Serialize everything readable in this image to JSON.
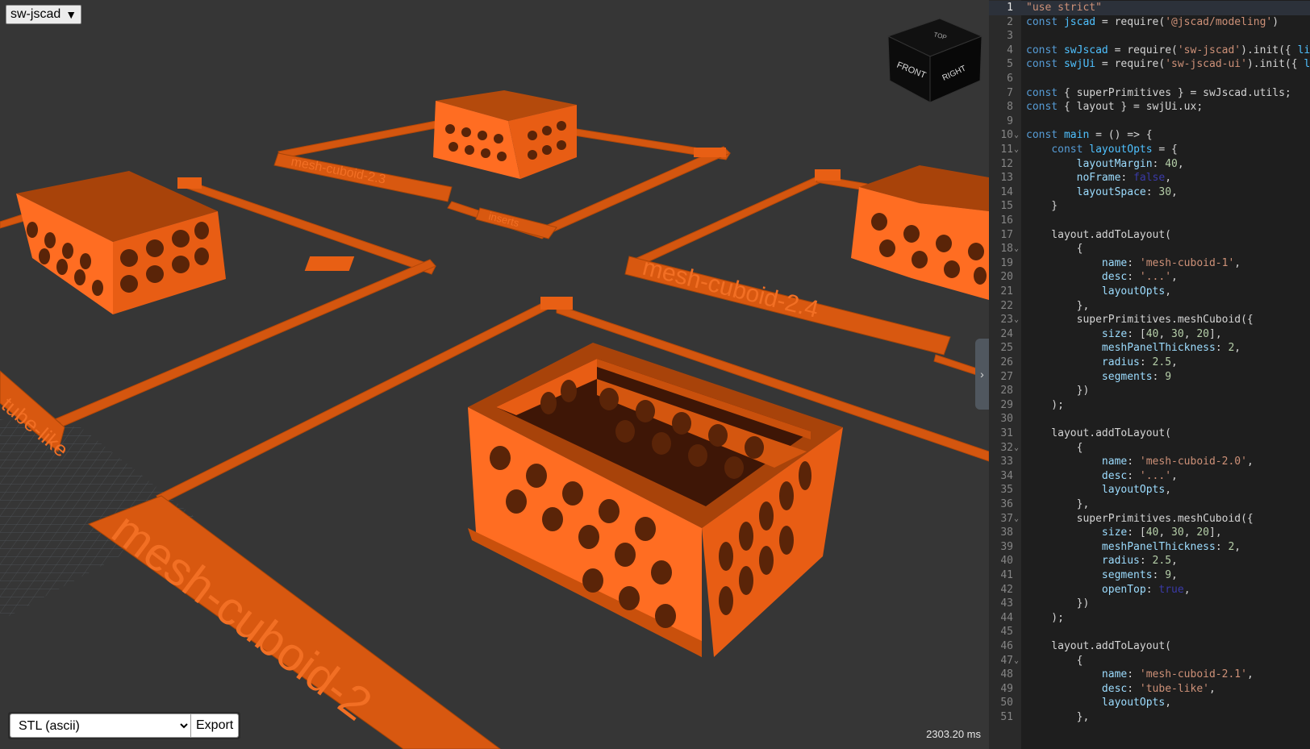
{
  "viewport": {
    "library_dropdown": "sw-jscad",
    "format_select_value": "STL (ascii)",
    "export_button": "Export",
    "render_time": "2303.20 ms",
    "view_cube": {
      "top": "TOP",
      "front": "FRONT",
      "right": "RIGHT"
    },
    "panel_toggle_icon": "chevron-right-icon",
    "model_labels": [
      "mesh-cuboid-2.3",
      "inserts",
      "mesh-cuboid-2.4",
      "tube-like",
      "mesh-cuboid-2"
    ],
    "colors": {
      "model": "#ff6a1a",
      "background": "#363636"
    }
  },
  "editor": {
    "lines": [
      {
        "n": "1",
        "fold": false,
        "tokens": [
          [
            "str",
            "\"use strict\""
          ]
        ]
      },
      {
        "n": "2",
        "fold": false,
        "tokens": [
          [
            "kw",
            "const "
          ],
          [
            "var",
            "jscad"
          ],
          [
            "txt",
            " = require("
          ],
          [
            "str",
            "'@jscad/modeling'"
          ],
          [
            "txt",
            ")"
          ]
        ]
      },
      {
        "n": "3",
        "fold": false,
        "tokens": []
      },
      {
        "n": "4",
        "fold": false,
        "tokens": [
          [
            "kw",
            "const "
          ],
          [
            "var",
            "swJscad"
          ],
          [
            "txt",
            " = require("
          ],
          [
            "str",
            "'sw-jscad'"
          ],
          [
            "txt",
            ").init({ "
          ],
          [
            "var",
            "li"
          ]
        ]
      },
      {
        "n": "5",
        "fold": false,
        "tokens": [
          [
            "kw",
            "const "
          ],
          [
            "var",
            "swjUi"
          ],
          [
            "txt",
            " = require("
          ],
          [
            "str",
            "'sw-jscad-ui'"
          ],
          [
            "txt",
            ").init({ "
          ],
          [
            "var",
            "l"
          ]
        ]
      },
      {
        "n": "6",
        "fold": false,
        "tokens": []
      },
      {
        "n": "7",
        "fold": false,
        "tokens": [
          [
            "kw",
            "const "
          ],
          [
            "txt",
            "{ superPrimitives } = swJscad.utils;"
          ]
        ]
      },
      {
        "n": "8",
        "fold": false,
        "tokens": [
          [
            "kw",
            "const "
          ],
          [
            "txt",
            "{ layout } = swjUi.ux;"
          ]
        ]
      },
      {
        "n": "9",
        "fold": false,
        "tokens": []
      },
      {
        "n": "10",
        "fold": true,
        "tokens": [
          [
            "kw",
            "const "
          ],
          [
            "var",
            "main"
          ],
          [
            "txt",
            " = () => {"
          ]
        ]
      },
      {
        "n": "11",
        "fold": true,
        "tokens": [
          [
            "txt",
            "    "
          ],
          [
            "kw",
            "const "
          ],
          [
            "var",
            "layoutOpts"
          ],
          [
            "txt",
            " = {"
          ]
        ]
      },
      {
        "n": "12",
        "fold": false,
        "tokens": [
          [
            "txt",
            "        "
          ],
          [
            "prop",
            "layoutMargin"
          ],
          [
            "txt",
            ": "
          ],
          [
            "num",
            "40"
          ],
          [
            "txt",
            ","
          ]
        ]
      },
      {
        "n": "13",
        "fold": false,
        "tokens": [
          [
            "txt",
            "        "
          ],
          [
            "prop",
            "noFrame"
          ],
          [
            "txt",
            ": "
          ],
          [
            "bool",
            "false"
          ],
          [
            "txt",
            ","
          ]
        ]
      },
      {
        "n": "14",
        "fold": false,
        "tokens": [
          [
            "txt",
            "        "
          ],
          [
            "prop",
            "layoutSpace"
          ],
          [
            "txt",
            ": "
          ],
          [
            "num",
            "30"
          ],
          [
            "txt",
            ","
          ]
        ]
      },
      {
        "n": "15",
        "fold": false,
        "tokens": [
          [
            "txt",
            "    }"
          ]
        ]
      },
      {
        "n": "16",
        "fold": false,
        "tokens": []
      },
      {
        "n": "17",
        "fold": false,
        "tokens": [
          [
            "txt",
            "    layout.addToLayout("
          ]
        ]
      },
      {
        "n": "18",
        "fold": true,
        "tokens": [
          [
            "txt",
            "        {"
          ]
        ]
      },
      {
        "n": "19",
        "fold": false,
        "tokens": [
          [
            "txt",
            "            "
          ],
          [
            "prop",
            "name"
          ],
          [
            "txt",
            ": "
          ],
          [
            "str",
            "'mesh-cuboid-1'"
          ],
          [
            "txt",
            ","
          ]
        ]
      },
      {
        "n": "20",
        "fold": false,
        "tokens": [
          [
            "txt",
            "            "
          ],
          [
            "prop",
            "desc"
          ],
          [
            "txt",
            ": "
          ],
          [
            "str",
            "'...'"
          ],
          [
            "txt",
            ","
          ]
        ]
      },
      {
        "n": "21",
        "fold": false,
        "tokens": [
          [
            "txt",
            "            "
          ],
          [
            "prop",
            "layoutOpts"
          ],
          [
            "txt",
            ","
          ]
        ]
      },
      {
        "n": "22",
        "fold": false,
        "tokens": [
          [
            "txt",
            "        },"
          ]
        ]
      },
      {
        "n": "23",
        "fold": true,
        "tokens": [
          [
            "txt",
            "        superPrimitives.meshCuboid({"
          ]
        ]
      },
      {
        "n": "24",
        "fold": false,
        "tokens": [
          [
            "txt",
            "            "
          ],
          [
            "prop",
            "size"
          ],
          [
            "txt",
            ": ["
          ],
          [
            "num",
            "40"
          ],
          [
            "txt",
            ", "
          ],
          [
            "num",
            "30"
          ],
          [
            "txt",
            ", "
          ],
          [
            "num",
            "20"
          ],
          [
            "txt",
            "],"
          ]
        ]
      },
      {
        "n": "25",
        "fold": false,
        "tokens": [
          [
            "txt",
            "            "
          ],
          [
            "prop",
            "meshPanelThickness"
          ],
          [
            "txt",
            ": "
          ],
          [
            "num",
            "2"
          ],
          [
            "txt",
            ","
          ]
        ]
      },
      {
        "n": "26",
        "fold": false,
        "tokens": [
          [
            "txt",
            "            "
          ],
          [
            "prop",
            "radius"
          ],
          [
            "txt",
            ": "
          ],
          [
            "num",
            "2.5"
          ],
          [
            "txt",
            ","
          ]
        ]
      },
      {
        "n": "27",
        "fold": false,
        "tokens": [
          [
            "txt",
            "            "
          ],
          [
            "prop",
            "segments"
          ],
          [
            "txt",
            ": "
          ],
          [
            "num",
            "9"
          ]
        ]
      },
      {
        "n": "28",
        "fold": false,
        "tokens": [
          [
            "txt",
            "        })"
          ]
        ]
      },
      {
        "n": "29",
        "fold": false,
        "tokens": [
          [
            "txt",
            "    );"
          ]
        ]
      },
      {
        "n": "30",
        "fold": false,
        "tokens": []
      },
      {
        "n": "31",
        "fold": false,
        "tokens": [
          [
            "txt",
            "    layout.addToLayout("
          ]
        ]
      },
      {
        "n": "32",
        "fold": true,
        "tokens": [
          [
            "txt",
            "        {"
          ]
        ]
      },
      {
        "n": "33",
        "fold": false,
        "tokens": [
          [
            "txt",
            "            "
          ],
          [
            "prop",
            "name"
          ],
          [
            "txt",
            ": "
          ],
          [
            "str",
            "'mesh-cuboid-2.0'"
          ],
          [
            "txt",
            ","
          ]
        ]
      },
      {
        "n": "34",
        "fold": false,
        "tokens": [
          [
            "txt",
            "            "
          ],
          [
            "prop",
            "desc"
          ],
          [
            "txt",
            ": "
          ],
          [
            "str",
            "'...'"
          ],
          [
            "txt",
            ","
          ]
        ]
      },
      {
        "n": "35",
        "fold": false,
        "tokens": [
          [
            "txt",
            "            "
          ],
          [
            "prop",
            "layoutOpts"
          ],
          [
            "txt",
            ","
          ]
        ]
      },
      {
        "n": "36",
        "fold": false,
        "tokens": [
          [
            "txt",
            "        },"
          ]
        ]
      },
      {
        "n": "37",
        "fold": true,
        "tokens": [
          [
            "txt",
            "        superPrimitives.meshCuboid({"
          ]
        ]
      },
      {
        "n": "38",
        "fold": false,
        "tokens": [
          [
            "txt",
            "            "
          ],
          [
            "prop",
            "size"
          ],
          [
            "txt",
            ": ["
          ],
          [
            "num",
            "40"
          ],
          [
            "txt",
            ", "
          ],
          [
            "num",
            "30"
          ],
          [
            "txt",
            ", "
          ],
          [
            "num",
            "20"
          ],
          [
            "txt",
            "],"
          ]
        ]
      },
      {
        "n": "39",
        "fold": false,
        "tokens": [
          [
            "txt",
            "            "
          ],
          [
            "prop",
            "meshPanelThickness"
          ],
          [
            "txt",
            ": "
          ],
          [
            "num",
            "2"
          ],
          [
            "txt",
            ","
          ]
        ]
      },
      {
        "n": "40",
        "fold": false,
        "tokens": [
          [
            "txt",
            "            "
          ],
          [
            "prop",
            "radius"
          ],
          [
            "txt",
            ": "
          ],
          [
            "num",
            "2.5"
          ],
          [
            "txt",
            ","
          ]
        ]
      },
      {
        "n": "41",
        "fold": false,
        "tokens": [
          [
            "txt",
            "            "
          ],
          [
            "prop",
            "segments"
          ],
          [
            "txt",
            ": "
          ],
          [
            "num",
            "9"
          ],
          [
            "txt",
            ","
          ]
        ]
      },
      {
        "n": "42",
        "fold": false,
        "tokens": [
          [
            "txt",
            "            "
          ],
          [
            "prop",
            "openTop"
          ],
          [
            "txt",
            ": "
          ],
          [
            "bool",
            "true"
          ],
          [
            "txt",
            ","
          ]
        ]
      },
      {
        "n": "43",
        "fold": false,
        "tokens": [
          [
            "txt",
            "        })"
          ]
        ]
      },
      {
        "n": "44",
        "fold": false,
        "tokens": [
          [
            "txt",
            "    );"
          ]
        ]
      },
      {
        "n": "45",
        "fold": false,
        "tokens": []
      },
      {
        "n": "46",
        "fold": false,
        "tokens": [
          [
            "txt",
            "    layout.addToLayout("
          ]
        ]
      },
      {
        "n": "47",
        "fold": true,
        "tokens": [
          [
            "txt",
            "        {"
          ]
        ]
      },
      {
        "n": "48",
        "fold": false,
        "tokens": [
          [
            "txt",
            "            "
          ],
          [
            "prop",
            "name"
          ],
          [
            "txt",
            ": "
          ],
          [
            "str",
            "'mesh-cuboid-2.1'"
          ],
          [
            "txt",
            ","
          ]
        ]
      },
      {
        "n": "49",
        "fold": false,
        "tokens": [
          [
            "txt",
            "            "
          ],
          [
            "prop",
            "desc"
          ],
          [
            "txt",
            ": "
          ],
          [
            "str",
            "'tube-like'"
          ],
          [
            "txt",
            ","
          ]
        ]
      },
      {
        "n": "50",
        "fold": false,
        "tokens": [
          [
            "txt",
            "            "
          ],
          [
            "prop",
            "layoutOpts"
          ],
          [
            "txt",
            ","
          ]
        ]
      },
      {
        "n": "51",
        "fold": false,
        "tokens": [
          [
            "txt",
            "        },"
          ]
        ]
      }
    ]
  }
}
